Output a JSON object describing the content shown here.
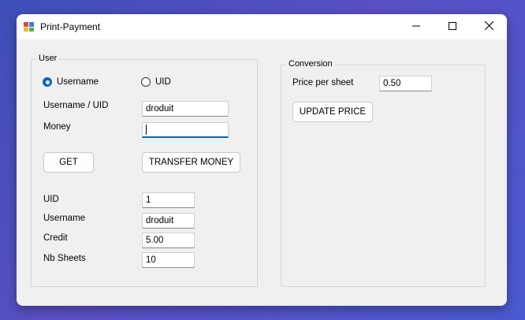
{
  "window": {
    "title": "Print-Payment"
  },
  "user_group": {
    "legend": "User",
    "radio_username": {
      "label": "Username",
      "checked": true
    },
    "radio_uid": {
      "label": "UID",
      "checked": false
    },
    "username_uid_label": "Username / UID",
    "username_uid_value": "droduit",
    "money_label": "Money",
    "money_value": "",
    "get_button": "GET",
    "transfer_button": "TRANSFER MONEY",
    "uid_label": "UID",
    "uid_value": "1",
    "username_label": "Username",
    "username_value": "droduit",
    "credit_label": "Credit",
    "credit_value": "5.00",
    "nb_sheets_label": "Nb Sheets",
    "nb_sheets_value": "10"
  },
  "conversion_group": {
    "legend": "Conversion",
    "price_label": "Price per sheet",
    "price_value": "0.50",
    "update_button": "UPDATE PRICE"
  },
  "icons": {
    "app": "printer-icon",
    "minimize": "minimize-icon",
    "maximize": "maximize-icon",
    "close": "close-icon"
  },
  "colors": {
    "accent": "#0067c0",
    "window_bg": "#f0f0f0"
  }
}
